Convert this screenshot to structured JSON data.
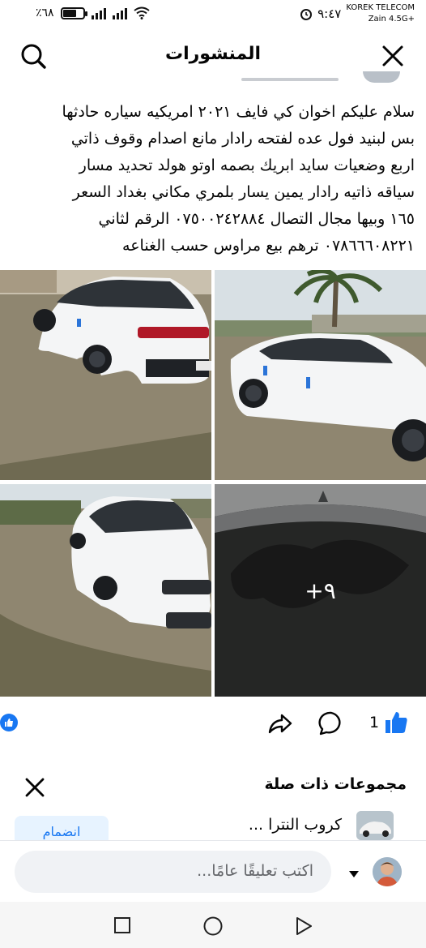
{
  "status": {
    "battery": "٪٦٨",
    "battery_level": 0.68,
    "time": "٩:٤٧",
    "carrier_line1": "KOREK TELECOM",
    "carrier_line2": "Zain 4.5G+"
  },
  "header": {
    "title": "المنشورات"
  },
  "post": {
    "lines": [
      "سلام عليكم اخوان كي فايف ٢٠٢١ امريكيه سياره حادثها",
      "بس لبنيد فول عده لفتحه رادار مانع اصدام وقوف ذاتي",
      "اربع وضعيات سايد ابريك بصمه اوتو هولد تحديد مسار",
      "سياقه ذاتيه رادار يمين يسار بلمري  مكاني بغداد السعر",
      "١٦٥ وبيها مجال التصال ٠٧٥٠٠٢٤٢٨٨٤ الرقم لثاني",
      "٠٧٨٦٦٦٠٨٢٢١ ترهم بيع مراوس حسب الغناعه"
    ],
    "more_photos": "+٩",
    "reactions_count": "1"
  },
  "related": {
    "title": "مجموعات ذات صلة",
    "group_name": "كروب النترا ...",
    "join_label": "انضمام"
  },
  "comment": {
    "placeholder": "اكتب تعليقًا عامًا..."
  },
  "colors": {
    "accent": "#1877f2",
    "input_bg": "#f0f2f5"
  }
}
